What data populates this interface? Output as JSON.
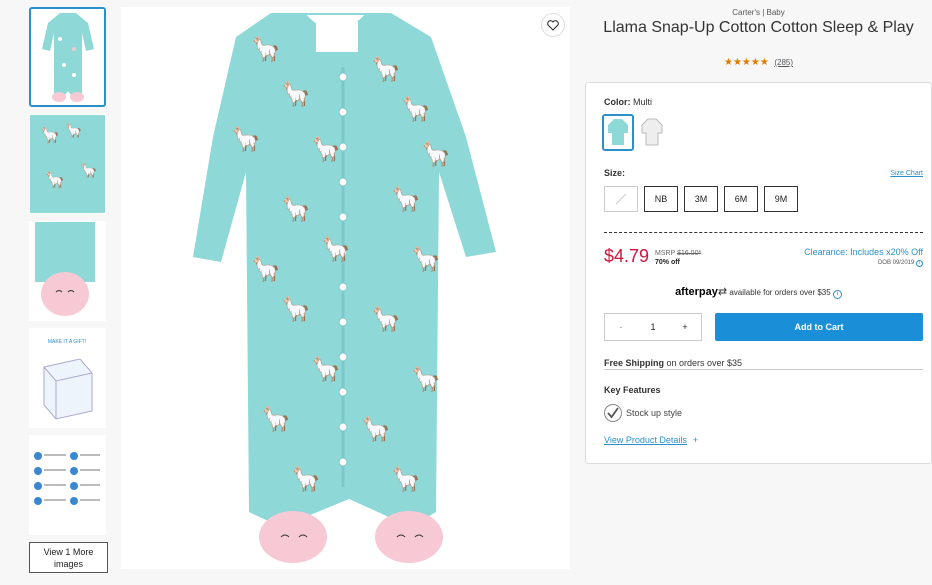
{
  "product": {
    "brand": "Carter's | Baby",
    "title": "Llama Snap-Up Cotton Cotton Sleep & Play",
    "stars": "★★★★★",
    "rating_count": "(285)"
  },
  "gallery": {
    "more_label_line1": "View 1 More",
    "more_label_line2": "images",
    "gift_text": "MAKE IT A GIFT!"
  },
  "options": {
    "color_label": "Color:",
    "color_value": "Multi",
    "size_label": "Size:",
    "size_chart": "Size Chart",
    "sizes": [
      "NB",
      "3M",
      "6M",
      "9M"
    ]
  },
  "pricing": {
    "price": "$4.79",
    "msrp_label": "MSRP",
    "msrp_value": "$16.00*",
    "discount": "70% off",
    "clearance": "Clearance: Includes x20% Off",
    "dob": "DOB 09/2019"
  },
  "afterpay": {
    "brand": "afterpay",
    "text": "available for orders over $35"
  },
  "cart": {
    "minus": "-",
    "quantity": "1",
    "plus": "+",
    "add_label": "Add to Cart"
  },
  "shipping": {
    "bold": "Free Shipping",
    "rest": " on orders over $35"
  },
  "features": {
    "heading": "Key Features",
    "items": [
      "Stock up style"
    ],
    "details_link": "View Product Details",
    "details_plus": "+"
  },
  "colors": {
    "accent": "#2b8fcb",
    "price_red": "#d0143d",
    "cart_blue": "#1a8fd8",
    "star_orange": "#e07b00",
    "garment_teal": "#8ed8d8"
  }
}
